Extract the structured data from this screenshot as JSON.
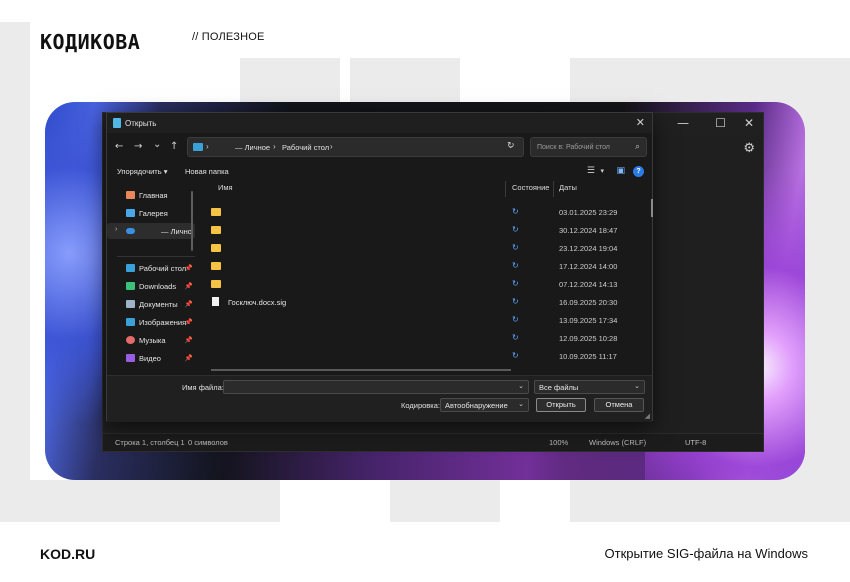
{
  "article": {
    "brand_logo": "КОДИКОВА",
    "section": "// ПОЛЕЗНОЕ",
    "site": "KOD.RU",
    "caption": "Открытие SIG-файла на Windows"
  },
  "dialog": {
    "title": "Открыть",
    "close_glyph": "✕",
    "nav": {
      "back": "←",
      "forward": "→",
      "recent": "⌄",
      "up": "↑"
    },
    "address": {
      "sep1": "›",
      "crumb1": "— Личное",
      "sep2": "›",
      "crumb2": "Рабочий стол",
      "sep3": "›",
      "dropdown": "⌄"
    },
    "refresh_glyph": "↻",
    "search": {
      "placeholder": "Поиск в: Рабочий стол",
      "icon": "⌕"
    },
    "toolbar": {
      "organize": "Упорядочить",
      "organize_caret": "▾",
      "new_folder": "Новая папка",
      "view_glyph": "☰",
      "view_caret": "▾",
      "pane_glyph": "▣",
      "help_glyph": "?"
    },
    "nav_pane": {
      "items": [
        {
          "label": "Главная",
          "icon": "home-icon",
          "color": "#e8875a"
        },
        {
          "label": "Галерея",
          "icon": "gallery-icon",
          "color": "#4aa7e8"
        },
        {
          "label": "— Личное",
          "icon": "onedrive-icon",
          "color": "#3a8fe0",
          "expand": "›"
        },
        {
          "label": "Рабочий стол",
          "icon": "desktop-icon",
          "color": "#3aa0d8",
          "pin": "📌"
        },
        {
          "label": "Downloads",
          "icon": "download-icon",
          "color": "#3cc07a",
          "pin": "📌"
        },
        {
          "label": "Документы",
          "icon": "documents-icon",
          "color": "#9fb3c8",
          "pin": "📌"
        },
        {
          "label": "Изображения",
          "icon": "pictures-icon",
          "color": "#3aa0d8",
          "pin": "📌"
        },
        {
          "label": "Музыка",
          "icon": "music-icon",
          "color": "#e56a6a",
          "pin": "📌"
        },
        {
          "label": "Видео",
          "icon": "video-icon",
          "color": "#9a5de0",
          "pin": "📌"
        }
      ]
    },
    "columns": {
      "name": "Имя",
      "status": "Состояние",
      "date": "Даты"
    },
    "files": [
      {
        "name": "",
        "type": "folder",
        "sync": "↻",
        "date": "03.01.2025 23:29"
      },
      {
        "name": "",
        "type": "folder",
        "sync": "↻",
        "date": "30.12.2024 18:47"
      },
      {
        "name": "",
        "type": "folder",
        "sync": "↻",
        "date": "23.12.2024 19:04"
      },
      {
        "name": "",
        "type": "folder",
        "sync": "↻",
        "date": "17.12.2024 14:00"
      },
      {
        "name": "",
        "type": "folder",
        "sync": "↻",
        "date": "07.12.2024 14:13"
      },
      {
        "name": "Госключ.docx.sig",
        "type": "doc",
        "sync": "↻",
        "date": "16.09.2025 20:30"
      },
      {
        "name": "",
        "type": "none",
        "sync": "↻",
        "date": "13.09.2025 17:34"
      },
      {
        "name": "",
        "type": "none",
        "sync": "↻",
        "date": "12.09.2025 10:28"
      },
      {
        "name": "",
        "type": "none",
        "sync": "↻",
        "date": "10.09.2025 11:17"
      }
    ],
    "footer": {
      "filename_label": "Имя файла:",
      "filename_value": "",
      "filename_caret": "⌄",
      "filter_value": "Все файлы",
      "filter_caret": "⌄",
      "encoding_label": "Кодировка:",
      "encoding_value": "Автообнаружение",
      "encoding_caret": "⌄",
      "open": "Открыть",
      "cancel": "Отмена",
      "grip": "◢"
    }
  },
  "notepad": {
    "min": "—",
    "max": "☐",
    "close": "✕",
    "gear": "⚙",
    "status": {
      "pos": "Строка 1, столбец 1",
      "chars": "0 символов",
      "zoom": "100%",
      "eol": "Windows (CRLF)",
      "enc": "UTF-8"
    }
  }
}
